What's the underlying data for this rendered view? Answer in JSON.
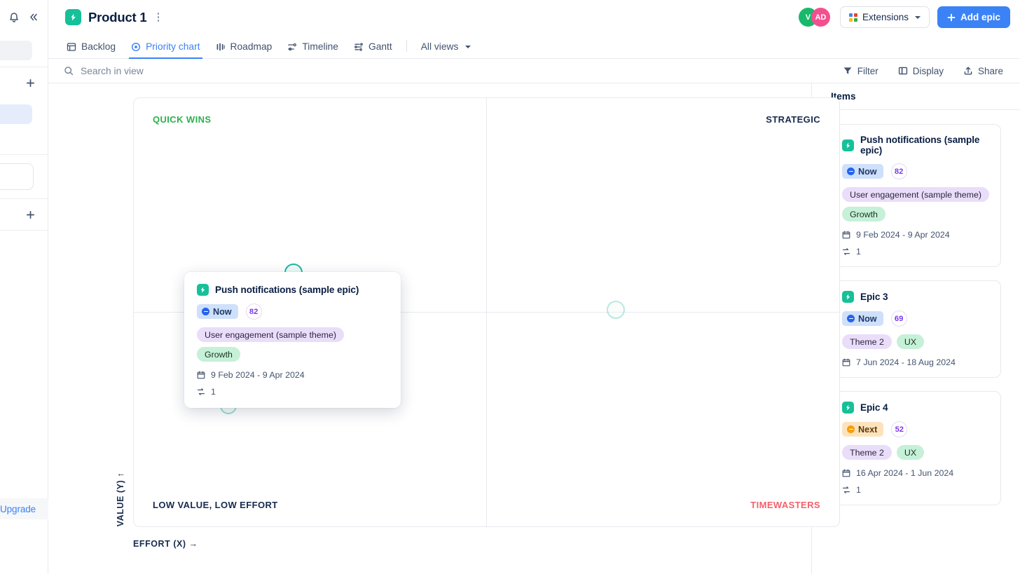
{
  "rail": {
    "notifications_icon": "bell-icon",
    "collapse_icon": "double-chevron-left-icon",
    "upgrade_label": "Upgrade",
    "add_icon": "plus-icon"
  },
  "header": {
    "product_icon": "lightning-bolt-icon",
    "title": "Product 1",
    "kebab_icon": "more-options-icon",
    "avatars": [
      {
        "initials": "V",
        "color": "#18b96b"
      },
      {
        "initials": "AD",
        "color": "#f2508f"
      }
    ],
    "extensions_label": "Extensions",
    "extensions_icon": "apps-grid-icon",
    "add_epic_label": "Add epic",
    "add_epic_icon": "plus-icon",
    "accent_color": "#3b82f6"
  },
  "tabs": {
    "items": [
      {
        "label": "Backlog",
        "icon": "backlog-icon",
        "active": false
      },
      {
        "label": "Priority chart",
        "icon": "target-icon",
        "active": true
      },
      {
        "label": "Roadmap",
        "icon": "roadmap-icon",
        "active": false
      },
      {
        "label": "Timeline",
        "icon": "timeline-icon",
        "active": false
      },
      {
        "label": "Gantt",
        "icon": "gantt-icon",
        "active": false
      }
    ],
    "all_views_label": "All views",
    "all_views_icon": "chevron-down-icon"
  },
  "toolbar": {
    "search_icon": "search-icon",
    "search_placeholder": "Search in view",
    "search_value": "",
    "filter_label": "Filter",
    "filter_icon": "funnel-icon",
    "display_label": "Display",
    "display_icon": "layout-icon",
    "share_label": "Share",
    "share_icon": "share-icon"
  },
  "chart_data": {
    "type": "scatter",
    "title": "Priority chart",
    "xlabel": "EFFORT (X) →",
    "ylabel": "VALUE (Y) ↑",
    "xlim": [
      0,
      100
    ],
    "ylim": [
      0,
      100
    ],
    "grid": true,
    "quadrants": [
      {
        "key": "tl",
        "label": "QUICK WINS",
        "color": "#2bb24c"
      },
      {
        "key": "tr",
        "label": "STRATEGIC",
        "color": "#172b4d"
      },
      {
        "key": "bl",
        "label": "LOW VALUE, LOW EFFORT",
        "color": "#172b4d"
      },
      {
        "key": "br",
        "label": "TIMEWASTERS",
        "color": "#f4616b"
      }
    ],
    "points": [
      {
        "name": "Push notifications (sample epic)",
        "x_pct": 22.6,
        "y_pct": 59.2,
        "size": 26,
        "color": "#1bb9a0",
        "opacity": 1,
        "hovered": true
      },
      {
        "name": "Epic 3",
        "x_pct": 68.3,
        "y_pct": 50.6,
        "size": 26,
        "color": "#1bb9a0",
        "opacity": 0.3,
        "hovered": false
      },
      {
        "name": "Epic 4",
        "x_pct": 13.4,
        "y_pct": 28.1,
        "size": 24,
        "color": "#1bb9a0",
        "opacity": 0.45,
        "hovered": false
      }
    ]
  },
  "tooltip": {
    "icon": "lightning-bolt-icon",
    "name": "Push notifications (sample epic)",
    "status": "Now",
    "status_kind": "now",
    "status_icon": "minus-circle-icon",
    "score": "82",
    "tags": [
      {
        "label": "User engagement (sample theme)",
        "kind": "purple"
      },
      {
        "label": "Growth",
        "kind": "green"
      }
    ],
    "date_icon": "calendar-icon",
    "dates": "9 Feb 2024 - 9 Apr 2024",
    "link_icon": "dependency-icon",
    "link_count": "1"
  },
  "panel": {
    "title": "Items",
    "cards": [
      {
        "icon": "lightning-bolt-icon",
        "name": "Push notifications (sample epic)",
        "status": "Now",
        "status_kind": "now",
        "score": "82",
        "tags": [
          {
            "label": "User engagement (sample theme)",
            "kind": "purple"
          },
          {
            "label": "Growth",
            "kind": "green"
          }
        ],
        "date_icon": "calendar-icon",
        "dates": "9 Feb 2024 - 9 Apr 2024",
        "link_icon": "dependency-icon",
        "link_count": "1"
      },
      {
        "icon": "lightning-bolt-icon",
        "name": "Epic 3",
        "status": "Now",
        "status_kind": "now",
        "score": "69",
        "tags": [
          {
            "label": "Theme 2",
            "kind": "purple"
          },
          {
            "label": "UX",
            "kind": "green"
          }
        ],
        "date_icon": "calendar-icon",
        "dates": "7 Jun 2024 - 18 Aug 2024",
        "link_icon": null,
        "link_count": null
      },
      {
        "icon": "lightning-bolt-icon",
        "name": "Epic 4",
        "status": "Next",
        "status_kind": "next",
        "score": "52",
        "tags": [
          {
            "label": "Theme 2",
            "kind": "purple"
          },
          {
            "label": "UX",
            "kind": "green"
          }
        ],
        "date_icon": "calendar-icon",
        "dates": "16 Apr 2024 - 1 Jun 2024",
        "link_icon": "dependency-icon",
        "link_count": "1"
      }
    ]
  }
}
